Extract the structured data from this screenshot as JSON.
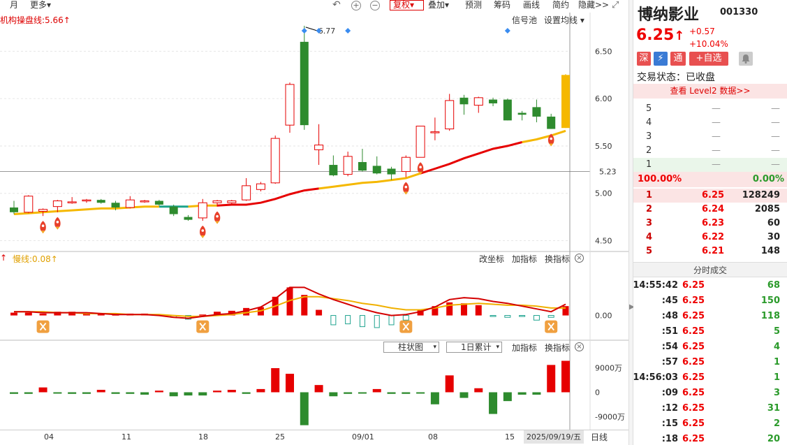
{
  "toolbar": {
    "month": "月",
    "more": "更多",
    "fuquan": "复权",
    "overlay": "叠加",
    "forecast": "预测",
    "chips": "筹码",
    "draw": "画线",
    "simple": "简约",
    "hide": "隐藏>>",
    "more_arrow": "▾",
    "undo_icon": "↶",
    "zoom_in_icon": "+",
    "zoom_out_icon": "−",
    "expand_icon": "⤢"
  },
  "main_pane": {
    "indicator_label": "机构操盘线:5.66↑",
    "signal_pool": "信号池",
    "set_ma": "设置均线",
    "set_ma_arrow": "▾",
    "max_annotation": "6.77",
    "cursor_price": "5.23",
    "y_ticks": [
      "6.50",
      "6.00",
      "5.50",
      "5.00",
      "4.50"
    ]
  },
  "macd_pane": {
    "up_arrow": "↑",
    "slow_line_label": "慢线:0.08↑",
    "change_coord": "改坐标",
    "add_indicator": "加指标",
    "switch_indicator": "换指标",
    "close_icon": "×",
    "y_tick": "0.00"
  },
  "volume_pane": {
    "chart_type": "柱状图",
    "accumulation": "1日累计",
    "dropdown_arrow": "▾",
    "add_indicator": "加指标",
    "switch_indicator": "换指标",
    "close_icon": "×",
    "y_ticks": [
      "9000万",
      "0",
      "-9000万"
    ]
  },
  "date_axis": {
    "labels": [
      "04",
      "11",
      "18",
      "25",
      "09/01",
      "08",
      "15"
    ],
    "cursor_date": "2025/09/19/五",
    "period": "日线"
  },
  "stock": {
    "name": "博纳影业",
    "code": "001330",
    "price": "6.25",
    "price_arrow": "↑",
    "change": "+0.57",
    "change_pct": "+10.04%",
    "badges": [
      "深",
      "⚡",
      "通",
      "+自选"
    ],
    "trade_status": "交易状态：已收盘",
    "level2": "查看 Level2 数据>>"
  },
  "order_book": {
    "asks": [
      {
        "level": "5",
        "price": "—",
        "volume": "—"
      },
      {
        "level": "4",
        "price": "—",
        "volume": "—"
      },
      {
        "level": "3",
        "price": "—",
        "volume": "—"
      },
      {
        "level": "2",
        "price": "—",
        "volume": "—"
      },
      {
        "level": "1",
        "price": "—",
        "volume": "—"
      }
    ],
    "ratio_left": "100.00%",
    "ratio_right": "0.00%",
    "bids": [
      {
        "level": "1",
        "price": "6.25",
        "volume": "128249"
      },
      {
        "level": "2",
        "price": "6.24",
        "volume": "2085"
      },
      {
        "level": "3",
        "price": "6.23",
        "volume": "60"
      },
      {
        "level": "4",
        "price": "6.22",
        "volume": "30"
      },
      {
        "level": "5",
        "price": "6.21",
        "volume": "148"
      }
    ]
  },
  "ticks": {
    "title": "分时成交",
    "rows": [
      {
        "time": "14:55:42",
        "price": "6.25",
        "volume": "68"
      },
      {
        "time": ":45",
        "price": "6.25",
        "volume": "150"
      },
      {
        "time": ":48",
        "price": "6.25",
        "volume": "118"
      },
      {
        "time": ":51",
        "price": "6.25",
        "volume": "5"
      },
      {
        "time": ":54",
        "price": "6.25",
        "volume": "4"
      },
      {
        "time": ":57",
        "price": "6.25",
        "volume": "1"
      },
      {
        "time": "14:56:03",
        "price": "6.25",
        "volume": "1"
      },
      {
        "time": ":09",
        "price": "6.25",
        "volume": "3"
      },
      {
        "time": ":12",
        "price": "6.25",
        "volume": "31"
      },
      {
        "time": ":15",
        "price": "6.25",
        "volume": "2"
      },
      {
        "time": ":18",
        "price": "6.25",
        "volume": "20"
      }
    ]
  },
  "colors": {
    "up": "#e60000",
    "down": "#2e8b2e",
    "limit_up": "#f5b800",
    "ma_line": "#e60000",
    "ma_line_alt": "#f5b800",
    "dif_line": "#d40000",
    "dea_line": "#f0b000"
  },
  "chart_data": {
    "type": "candlestick",
    "candles": [
      {
        "o": 4.85,
        "h": 4.92,
        "l": 4.78,
        "c": 4.8
      },
      {
        "o": 4.8,
        "h": 4.98,
        "l": 4.79,
        "c": 4.97
      },
      {
        "o": 4.81,
        "h": 4.84,
        "l": 4.76,
        "c": 4.83
      },
      {
        "o": 4.86,
        "h": 4.93,
        "l": 4.8,
        "c": 4.92
      },
      {
        "o": 4.91,
        "h": 4.96,
        "l": 4.89,
        "c": 4.91
      },
      {
        "o": 4.92,
        "h": 4.94,
        "l": 4.9,
        "c": 4.93
      },
      {
        "o": 4.93,
        "h": 4.94,
        "l": 4.89,
        "c": 4.9
      },
      {
        "o": 4.9,
        "h": 4.92,
        "l": 4.82,
        "c": 4.85
      },
      {
        "o": 4.85,
        "h": 4.97,
        "l": 4.84,
        "c": 4.93
      },
      {
        "o": 4.92,
        "h": 4.93,
        "l": 4.9,
        "c": 4.92
      },
      {
        "o": 4.92,
        "h": 4.93,
        "l": 4.87,
        "c": 4.88
      },
      {
        "o": 4.86,
        "h": 4.88,
        "l": 4.76,
        "c": 4.78
      },
      {
        "o": 4.75,
        "h": 4.77,
        "l": 4.71,
        "c": 4.72
      },
      {
        "o": 4.74,
        "h": 4.94,
        "l": 4.71,
        "c": 4.9
      },
      {
        "o": 4.9,
        "h": 4.93,
        "l": 4.86,
        "c": 4.92
      },
      {
        "o": 4.9,
        "h": 4.93,
        "l": 4.89,
        "c": 4.92
      },
      {
        "o": 4.93,
        "h": 5.16,
        "l": 4.92,
        "c": 5.08
      },
      {
        "o": 5.04,
        "h": 5.12,
        "l": 5.02,
        "c": 5.1
      },
      {
        "o": 5.11,
        "h": 5.61,
        "l": 5.1,
        "c": 5.58
      },
      {
        "o": 5.72,
        "h": 6.17,
        "l": 5.64,
        "c": 6.15
      },
      {
        "o": 6.6,
        "h": 6.77,
        "l": 5.67,
        "c": 5.72
      },
      {
        "o": 5.46,
        "h": 5.73,
        "l": 5.3,
        "c": 5.51
      },
      {
        "o": 5.3,
        "h": 5.4,
        "l": 5.18,
        "c": 5.19
      },
      {
        "o": 5.2,
        "h": 5.44,
        "l": 5.18,
        "c": 5.39
      },
      {
        "o": 5.33,
        "h": 5.47,
        "l": 5.23,
        "c": 5.24
      },
      {
        "o": 5.29,
        "h": 5.39,
        "l": 5.2,
        "c": 5.21
      },
      {
        "o": 5.26,
        "h": 5.28,
        "l": 5.14,
        "c": 5.2
      },
      {
        "o": 5.23,
        "h": 5.4,
        "l": 5.17,
        "c": 5.38
      },
      {
        "o": 5.38,
        "h": 5.71,
        "l": 5.38,
        "c": 5.71
      },
      {
        "o": 5.65,
        "h": 5.8,
        "l": 5.56,
        "c": 5.65
      },
      {
        "o": 5.68,
        "h": 6.05,
        "l": 5.66,
        "c": 5.98
      },
      {
        "o": 6.01,
        "h": 6.04,
        "l": 5.83,
        "c": 5.94
      },
      {
        "o": 5.93,
        "h": 6.02,
        "l": 5.85,
        "c": 6.01
      },
      {
        "o": 5.99,
        "h": 6.01,
        "l": 5.92,
        "c": 5.95
      },
      {
        "o": 5.99,
        "h": 6.0,
        "l": 5.77,
        "c": 5.77
      },
      {
        "o": 5.85,
        "h": 5.87,
        "l": 5.77,
        "c": 5.83
      },
      {
        "o": 5.91,
        "h": 5.99,
        "l": 5.75,
        "c": 5.81
      },
      {
        "o": 5.81,
        "h": 5.84,
        "l": 5.68,
        "c": 5.68
      },
      {
        "o": 5.69,
        "h": 6.26,
        "l": 5.69,
        "c": 6.25
      }
    ],
    "ma_line": [
      4.78,
      4.79,
      4.8,
      4.81,
      4.82,
      4.83,
      4.84,
      4.84,
      4.85,
      4.86,
      4.86,
      4.86,
      4.86,
      4.87,
      4.87,
      4.88,
      4.88,
      4.9,
      4.94,
      4.99,
      5.03,
      5.05,
      5.07,
      5.09,
      5.11,
      5.12,
      5.14,
      5.16,
      5.21,
      5.26,
      5.31,
      5.37,
      5.42,
      5.47,
      5.5,
      5.54,
      5.57,
      5.61,
      5.66
    ],
    "ma_segments": [
      {
        "from": 0,
        "to": 10,
        "color": "#f5b800"
      },
      {
        "from": 10,
        "to": 12,
        "color": "#1ca38b"
      },
      {
        "from": 12,
        "to": 14,
        "color": "#f5b800"
      },
      {
        "from": 14,
        "to": 21,
        "color": "#e60000"
      },
      {
        "from": 21,
        "to": 28,
        "color": "#f5b800"
      },
      {
        "from": 28,
        "to": 35,
        "color": "#e60000"
      },
      {
        "from": 35,
        "to": 38,
        "color": "#f5b800"
      }
    ],
    "buy_signals": [
      2,
      3,
      13,
      14,
      27,
      28,
      37
    ],
    "diamonds": [
      20,
      21,
      23,
      34
    ],
    "macd_hist": [
      0.03,
      0.03,
      0.02,
      0.04,
      0.04,
      0.02,
      0.02,
      0.01,
      0.02,
      0.02,
      0.01,
      -0.02,
      -0.04,
      0.01,
      0.04,
      0.05,
      0.08,
      0.09,
      0.2,
      0.3,
      0.22,
      0.06,
      -0.1,
      -0.09,
      -0.12,
      -0.13,
      -0.1,
      -0.05,
      0.06,
      0.1,
      0.14,
      0.13,
      0.11,
      -0.01,
      -0.02,
      -0.01,
      -0.05,
      -0.02,
      0.1
    ],
    "macd_dif": [
      0.04,
      0.04,
      0.03,
      0.03,
      0.03,
      0.03,
      0.02,
      0.01,
      0.01,
      0.01,
      0.0,
      -0.02,
      -0.03,
      -0.01,
      0.01,
      0.02,
      0.05,
      0.09,
      0.18,
      0.3,
      0.3,
      0.23,
      0.17,
      0.12,
      0.07,
      0.03,
      0.0,
      0.01,
      0.04,
      0.09,
      0.17,
      0.19,
      0.18,
      0.15,
      0.13,
      0.1,
      0.07,
      0.04,
      0.12
    ],
    "macd_dea": [
      0.04,
      0.04,
      0.04,
      0.03,
      0.03,
      0.02,
      0.02,
      0.02,
      0.01,
      0.01,
      0.01,
      0.0,
      -0.01,
      -0.01,
      0.0,
      0.01,
      0.03,
      0.05,
      0.1,
      0.16,
      0.2,
      0.2,
      0.18,
      0.16,
      0.13,
      0.11,
      0.08,
      0.06,
      0.06,
      0.08,
      0.11,
      0.12,
      0.13,
      0.12,
      0.11,
      0.11,
      0.1,
      0.08,
      0.08
    ],
    "macd_markers": [
      2,
      13,
      27,
      37
    ],
    "volume_net": [
      -0.2,
      -0.2,
      0.6,
      -0.1,
      -0.2,
      -0.2,
      0.3,
      -0.2,
      -0.2,
      -0.3,
      0.2,
      -0.5,
      -0.4,
      -0.4,
      0.2,
      0.3,
      -0.2,
      0.4,
      3.0,
      2.3,
      -4.1,
      0.9,
      -0.5,
      -0.2,
      -0.1,
      0.4,
      -0.2,
      -0.2,
      -0.1,
      -1.5,
      2.1,
      -0.7,
      0.5,
      -2.7,
      -1.1,
      -0.3,
      -0.3,
      3.4,
      0
    ],
    "volume_ylim": [
      -9000,
      9000
    ],
    "price_ylim": [
      4.4,
      6.85
    ],
    "macd_ylim": [
      -0.25,
      0.55
    ]
  }
}
